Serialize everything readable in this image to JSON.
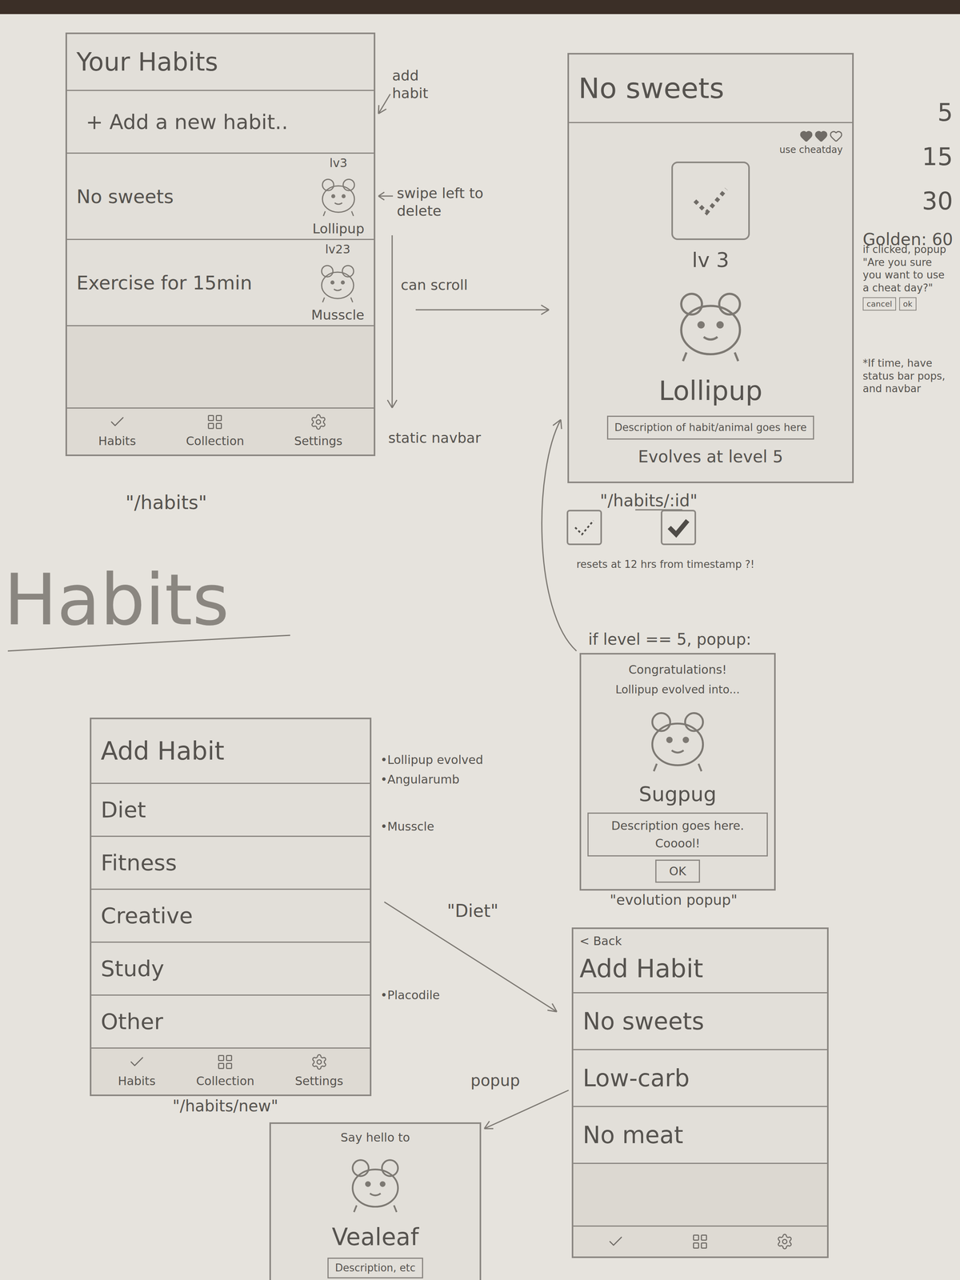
{
  "habits_page": {
    "title": "Your Habits",
    "add_row": "+ Add a new habit..",
    "habits": [
      {
        "name": "No sweets",
        "level": "lv3",
        "creature": "Lollipup"
      },
      {
        "name": "Exercise for 15min",
        "level": "lv23",
        "creature": "Musscle"
      }
    ],
    "navbar": [
      "Habits",
      "Collection",
      "Settings"
    ],
    "route": "\"/habits\"",
    "notes": {
      "add": "add habit",
      "swipe": "swipe left to delete",
      "scroll": "can scroll",
      "navbar": "static navbar"
    }
  },
  "detail_page": {
    "title": "No sweets",
    "hearts": [
      {
        "filled": true
      },
      {
        "filled": true
      },
      {
        "filled": false
      }
    ],
    "cheat_label": "use cheatday",
    "checked": false,
    "level": "lv 3",
    "creature": "Lollipup",
    "description": "Description of habit/animal goes here",
    "evolves": "Evolves at level 5",
    "route": "\"/habits/:id\""
  },
  "streak_levels": [
    "5",
    "15",
    "30",
    "Golden: 60"
  ],
  "cheat_note": {
    "text": "if clicked, popup \"Are you sure you want to use a cheat day?\"",
    "buttons": [
      "cancel",
      "ok"
    ]
  },
  "extra_note": "*If time, have status bar pops, and navbar",
  "check_demo": {
    "states": [
      {
        "checked": false
      },
      {
        "checked": true
      }
    ],
    "caption": "resets at 12 hrs from timestamp ?!"
  },
  "section_heading": "Habits",
  "evolution": {
    "condition": "if level == 5, popup:",
    "title": "Congratulations!",
    "subtitle": "Lollipup evolved into...",
    "creature": "Sugpug",
    "description": "Description goes here. Cooool!",
    "button": "OK",
    "label": "\"evolution popup\""
  },
  "add_page": {
    "title": "Add Habit",
    "categories": [
      "Diet",
      "Fitness",
      "Creative",
      "Study",
      "Other"
    ],
    "navbar": [
      "Habits",
      "Collection",
      "Settings"
    ],
    "route": "\"/habits/new\"",
    "creature_notes": [
      "•Lollipup evolved",
      "•Angularumb",
      "•Musscle",
      "•Placodile"
    ]
  },
  "diet_arrow_label": "\"Diet\"",
  "diet_page": {
    "back": "< Back",
    "title": "Add Habit",
    "items": [
      "No sweets",
      "Low-carb",
      "No meat"
    ]
  },
  "popup_label": "popup",
  "hello_popup": {
    "greeting": "Say hello to",
    "creature": "Vealeaf",
    "description": "Description, etc"
  }
}
